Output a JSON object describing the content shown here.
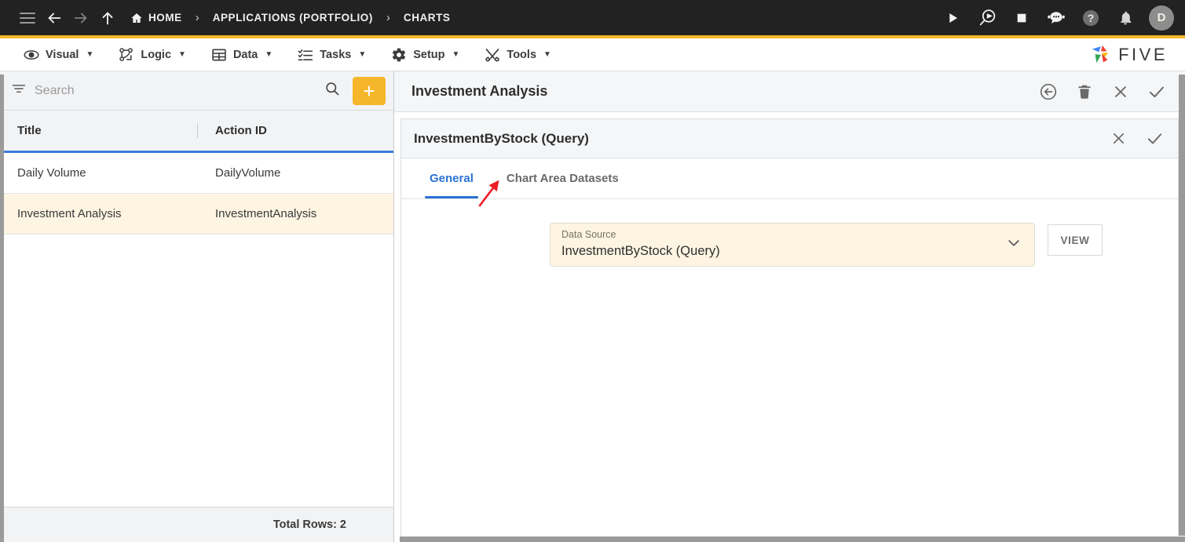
{
  "topbar": {
    "menu_icon": "hamburger-icon",
    "back_icon": "back-arrow-icon",
    "forward_icon": "forward-arrow-icon",
    "up_icon": "up-arrow-icon",
    "breadcrumbs": [
      {
        "label": "HOME",
        "icon": "home-icon"
      },
      {
        "label": "APPLICATIONS (PORTFOLIO)",
        "icon": ""
      },
      {
        "label": "CHARTS",
        "icon": ""
      }
    ],
    "separator": "›",
    "actions": [
      {
        "name": "run-icon",
        "title": "Run"
      },
      {
        "name": "debug-icon",
        "title": "Debug"
      },
      {
        "name": "stop-icon",
        "title": "Stop"
      },
      {
        "name": "chatbot-icon",
        "title": "Assistant"
      },
      {
        "name": "help-icon",
        "title": "Help"
      },
      {
        "name": "notifications-icon",
        "title": "Notifications"
      }
    ],
    "avatar_initial": "D"
  },
  "menubar": {
    "items": [
      {
        "label": "Visual",
        "icon": "eye-icon",
        "caret": "▼"
      },
      {
        "label": "Logic",
        "icon": "logic-nodes-icon",
        "caret": "▼"
      },
      {
        "label": "Data",
        "icon": "table-grid-icon",
        "caret": "▼"
      },
      {
        "label": "Tasks",
        "icon": "task-list-icon",
        "caret": "▼"
      },
      {
        "label": "Setup",
        "icon": "gear-icon",
        "caret": "▼"
      },
      {
        "label": "Tools",
        "icon": "tools-icon",
        "caret": "▼"
      }
    ],
    "brand": "FIVE"
  },
  "sidebar": {
    "search": {
      "placeholder": "Search",
      "value": ""
    },
    "filter_icon": "filter-icon",
    "search_icon": "search-icon",
    "add_label": "+",
    "columns": [
      "Title",
      "Action ID"
    ],
    "rows": [
      {
        "title": "Daily Volume",
        "action_id": "DailyVolume",
        "selected": false
      },
      {
        "title": "Investment Analysis",
        "action_id": "InvestmentAnalysis",
        "selected": true
      }
    ],
    "footer": "Total Rows: 2"
  },
  "panel": {
    "title": "Investment Analysis",
    "actions": [
      {
        "name": "revert-icon",
        "title": "Revert"
      },
      {
        "name": "delete-icon",
        "title": "Delete"
      },
      {
        "name": "close-icon",
        "title": "Close"
      },
      {
        "name": "save-icon",
        "title": "Save"
      }
    ]
  },
  "subpanel": {
    "title": "InvestmentByStock (Query)",
    "actions": [
      {
        "name": "close-icon",
        "title": "Close"
      },
      {
        "name": "save-icon",
        "title": "Save"
      }
    ],
    "tabs": [
      {
        "label": "General",
        "active": true
      },
      {
        "label": "Chart Area Datasets",
        "active": false
      }
    ],
    "form": {
      "data_source_label": "Data Source",
      "data_source_value": "InvestmentByStock (Query)",
      "dropdown_icon": "chevron-down-icon",
      "view_button": "VIEW"
    }
  },
  "colors": {
    "accent_yellow": "#F5B82E",
    "selection_cream": "#FDF4E2",
    "tab_blue": "#2B72D4",
    "header_dark": "#222222",
    "annotation_red": "#EE1C25"
  }
}
